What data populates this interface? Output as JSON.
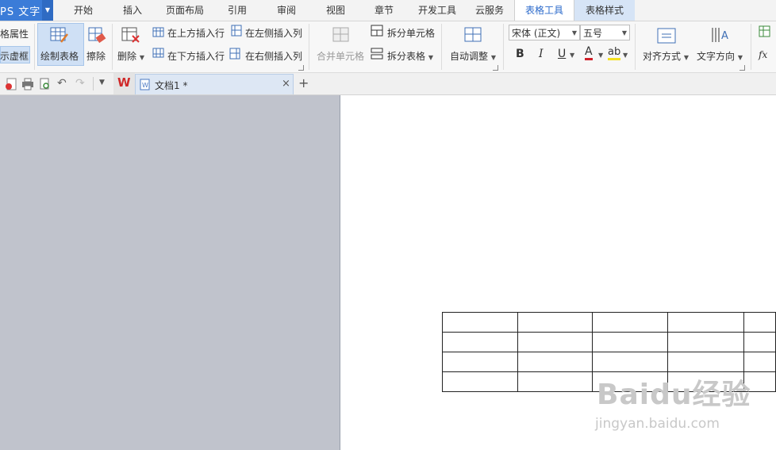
{
  "menubar": {
    "app_title": "PS 文字",
    "tabs": [
      {
        "label": "开始"
      },
      {
        "label": "插入"
      },
      {
        "label": "页面布局"
      },
      {
        "label": "引用"
      },
      {
        "label": "审阅"
      },
      {
        "label": "视图"
      },
      {
        "label": "章节"
      },
      {
        "label": "开发工具"
      },
      {
        "label": "云服务"
      },
      {
        "label": "表格工具"
      },
      {
        "label": "表格样式"
      }
    ],
    "active_tab": "表格工具"
  },
  "ribbon": {
    "properties": "格属性",
    "show_gridlines": "示虚框",
    "draw_table": "绘制表格",
    "erase": "擦除",
    "delete": "删除",
    "insert_row_above": "在上方插入行",
    "insert_row_below": "在下方插入行",
    "insert_col_left": "在左侧插入列",
    "insert_col_right": "在右侧插入列",
    "merge_cells": "合并单元格",
    "split_cells": "拆分单元格",
    "split_table": "拆分表格",
    "auto_fit": "自动调整",
    "font_name": "宋体 (正文)",
    "font_size": "五号",
    "bold": "B",
    "italic": "I",
    "underline": "U",
    "font_color": "A",
    "highlight": "ab",
    "align": "对齐方式",
    "text_direction": "文字方向",
    "formula": "fx"
  },
  "doc_tabs": {
    "items": [
      {
        "label": "文档1 *"
      }
    ]
  },
  "table": {
    "rows": 4,
    "cols": 5
  },
  "watermark": {
    "brand": "Baidu经验",
    "url": "jingyan.baidu.com"
  },
  "colors": {
    "accent": "#2b6acb",
    "app_button": "#3b7cd8",
    "canvas_gray": "#c0c3cc"
  }
}
